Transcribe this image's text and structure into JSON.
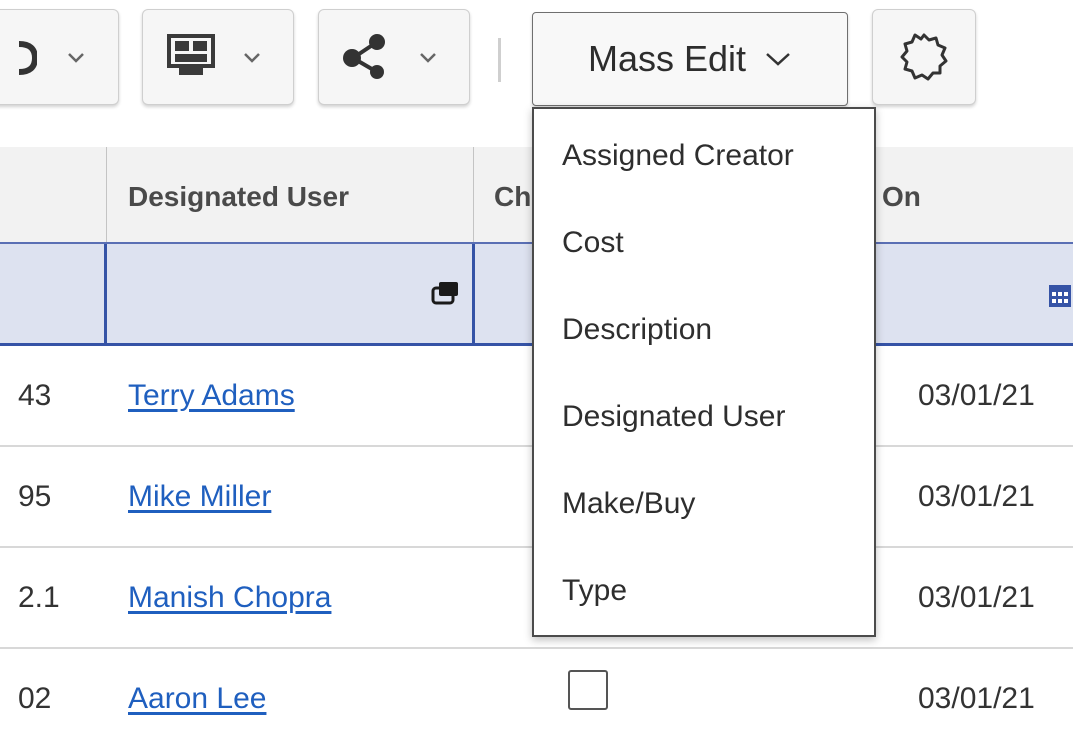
{
  "toolbar": {
    "mass_edit_label": "Mass Edit"
  },
  "grid": {
    "columns": {
      "designated_user": "Designated User",
      "changed_partial": "Ch",
      "date_partial": "On"
    },
    "rows": [
      {
        "number": "43",
        "user": "Terry Adams",
        "date": "03/01/21"
      },
      {
        "number": "95",
        "user": "Mike Miller",
        "date": "03/01/21"
      },
      {
        "number": "2.1",
        "user": "Manish Chopra",
        "date": "03/01/21"
      },
      {
        "number": "02",
        "user": "Aaron Lee",
        "date": "03/01/21"
      }
    ]
  },
  "mass_edit_menu": {
    "items": [
      "Assigned Creator",
      "Cost",
      "Description",
      "Designated User",
      "Make/Buy",
      "Type"
    ]
  },
  "colors": {
    "accent_blue": "#3553a6",
    "link_blue": "#1f5fbf",
    "filter_row_bg": "#dde2f0"
  },
  "icons": [
    "chevron-down-icon",
    "layout-view-icon",
    "share-icon",
    "settings-gear-icon",
    "popup-icon",
    "calendar-icon"
  ]
}
